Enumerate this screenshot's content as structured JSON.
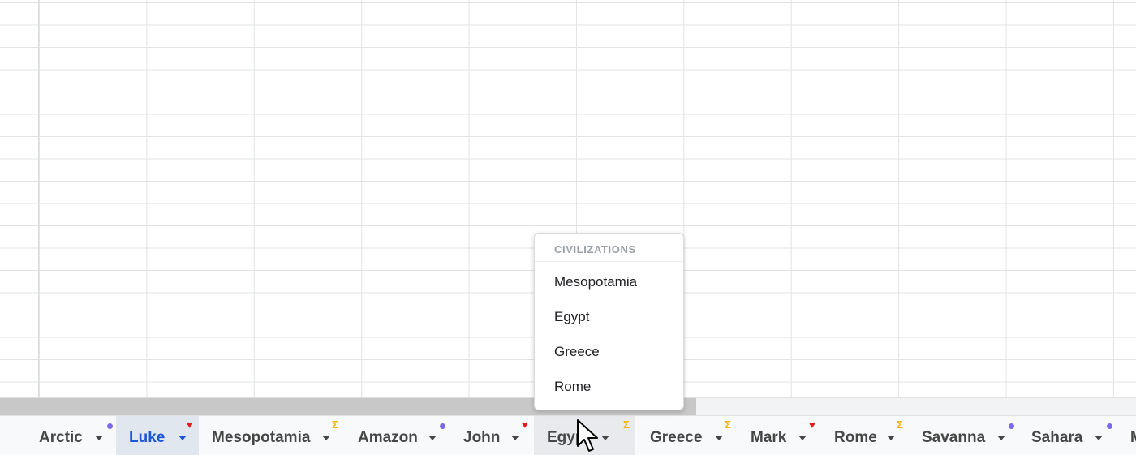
{
  "tabs": [
    {
      "label": "Arctic",
      "badge": "dot",
      "badge_color": "#7b68ee"
    },
    {
      "label": "Luke",
      "badge": "heart",
      "badge_color": "#e31c1c",
      "state": "active"
    },
    {
      "label": "Mesopotamia",
      "badge": "sigma",
      "badge_color": "#f4b400"
    },
    {
      "label": "Amazon",
      "badge": "dot",
      "badge_color": "#7b68ee"
    },
    {
      "label": "John",
      "badge": "heart",
      "badge_color": "#e31c1c"
    },
    {
      "label": "Egypt",
      "badge": "sigma",
      "badge_color": "#f4b400",
      "state": "hover"
    },
    {
      "label": "Greece",
      "badge": "sigma",
      "badge_color": "#f4b400"
    },
    {
      "label": "Mark",
      "badge": "heart",
      "badge_color": "#e31c1c"
    },
    {
      "label": "Rome",
      "badge": "sigma",
      "badge_color": "#f4b400"
    },
    {
      "label": "Savanna",
      "badge": "dot",
      "badge_color": "#7b68ee"
    },
    {
      "label": "Sahara",
      "badge": "dot",
      "badge_color": "#7b68ee"
    },
    {
      "label": "M"
    }
  ],
  "menu": {
    "header": "CIVILIZATIONS",
    "items": [
      "Mesopotamia",
      "Egypt",
      "Greece",
      "Rome"
    ]
  },
  "icons": {
    "heart": "♥",
    "sigma": "Σ",
    "cursor": "mouse-pointer-icon"
  }
}
